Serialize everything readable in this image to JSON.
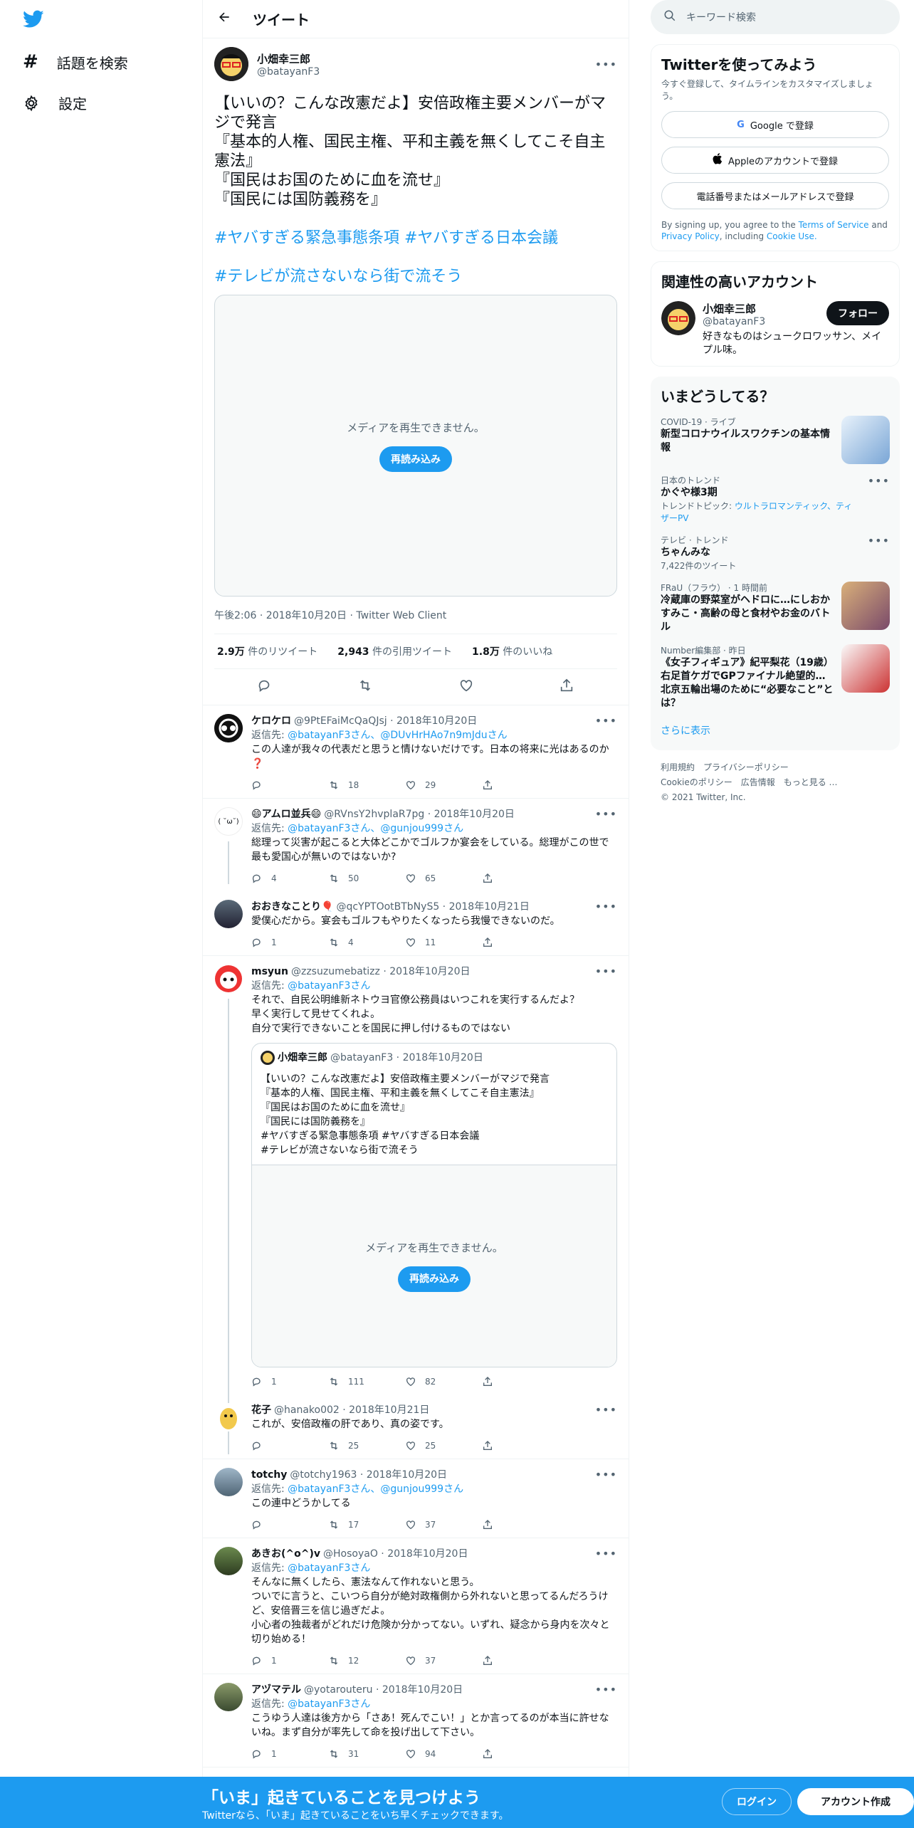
{
  "nav": {
    "explore_label": "話題を検索",
    "settings_label": "設定"
  },
  "header": {
    "title": "ツイート"
  },
  "main_tweet": {
    "name": "小畑幸三郎",
    "handle": "@batayanF3",
    "text": "【いいの？こんな改憲だよ】安倍政権主要メンバーがマジで発言\n『基本的人権、国民主権、平和主義を無くしてこそ自主憲法』\n『国民はお国のために血を流せ』\n『国民には国防義務を』",
    "hashtags_line1": "#ヤバすぎる緊急事態条項 #ヤバすぎる日本会議",
    "hashtags_line2": "#テレビが流さないなら街で流そう",
    "media_msg": "メディアを再生できません。",
    "reload_label": "再読み込み",
    "meta": "午後2:06 · 2018年10月20日 · Twitter Web Client",
    "retweets_num": "2.9万",
    "retweets_label": "件のリツイート",
    "quotes_num": "2,943",
    "quotes_label": "件の引用ツイート",
    "likes_num": "1.8万",
    "likes_label": "件のいいね"
  },
  "replies": [
    {
      "name": "ケロケロ",
      "handle": "@9PtEFaiMcQaQJsj · 2018年10月20日",
      "reply_to_prefix": "返信先: ",
      "reply_to": "@batayanF3さん、@DUvHrHAo7n9mJduさん",
      "text": "この人達が我々の代表だと思うと情けないだけです。日本の将来に光はあるのか❓",
      "replies": "",
      "rts": "18",
      "likes": "29"
    },
    {
      "name": "😄アムロ並兵😄",
      "handle": "@RVnsY2hvplaR7pg · 2018年10月20日",
      "reply_to_prefix": "返信先: ",
      "reply_to": "@batayanF3さん、@gunjou999さん",
      "text": "総理って災害が起こると大体どこかでゴルフか宴会をしている。総理がこの世で最も愛国心が無いのではないか?",
      "replies": "4",
      "rts": "50",
      "likes": "65"
    },
    {
      "name": "おおきなことり🎈",
      "handle": "@qcYPTOotBTbNyS5 · 2018年10月21日",
      "text": "愛僕心だから。宴会もゴルフもやりたくなったら我慢できないのだ。",
      "replies": "1",
      "rts": "4",
      "likes": "11"
    },
    {
      "name": "msyun",
      "handle": "@zzsuzumebatizz · 2018年10月20日",
      "reply_to_prefix": "返信先: ",
      "reply_to": "@batayanF3さん",
      "text": "それで、自民公明維新ネトウヨ官僚公務員はいつこれを実行するんだよ？\n早く実行して見せてくれよ。\n自分で実行できないことを国民に押し付けるものではない",
      "replies": "1",
      "rts": "111",
      "likes": "82",
      "quote": {
        "name": "小畑幸三郎",
        "handle": "@batayanF3 · 2018年10月20日",
        "text": "【いいの？こんな改憲だよ】安倍政権主要メンバーがマジで発言\n『基本的人権、国民主権、平和主義を無くしてこそ自主憲法』\n『国民はお国のために血を流せ』\n『国民には国防義務を』\n#ヤバすぎる緊急事態条項 #ヤバすぎる日本会議\n#テレビが流さないなら街で流そう",
        "media_msg": "メディアを再生できません。",
        "reload_label": "再読み込み"
      }
    },
    {
      "name": "花子",
      "handle": "@hanako002 · 2018年10月21日",
      "text": "これが、安倍政権の肝であり、真の姿です。",
      "replies": "",
      "rts": "25",
      "likes": "25"
    },
    {
      "name": "totchy",
      "handle": "@totchy1963 · 2018年10月20日",
      "reply_to_prefix": "返信先: ",
      "reply_to": "@batayanF3さん、@gunjou999さん",
      "text": "この連中どうかしてる",
      "replies": "",
      "rts": "17",
      "likes": "37"
    },
    {
      "name": "あきお(^o^)v",
      "handle": "@HosoyaO · 2018年10月20日",
      "reply_to_prefix": "返信先: ",
      "reply_to": "@batayanF3さん",
      "text": "そんなに無くしたら、憲法なんて作れないと思う。\nついでに言うと、こいつら自分が絶対政権側から外れないと思ってるんだろうけど、安倍晋三を信じ過ぎだよ。\n小心者の独裁者がどれだけ危険か分かってない。いずれ、疑念から身内を次々と切り始める！",
      "replies": "1",
      "rts": "12",
      "likes": "37"
    },
    {
      "name": "アヅマテル",
      "handle": "@yotarouteru · 2018年10月20日",
      "reply_to_prefix": "返信先: ",
      "reply_to": "@batayanF3さん",
      "text": "こうゆう人達は後方から「さあ！死んでこい！」とか言ってるのが本当に許せないね。まず自分が率先して命を投げ出して下さい。",
      "replies": "1",
      "rts": "31",
      "likes": "94"
    }
  ],
  "right": {
    "search_placeholder": "キーワード検索",
    "signup_title": "Twitterを使ってみよう",
    "signup_sub": "今すぐ登録して、タイムラインをカスタマイズしましょう。",
    "google_btn": "Google で登録",
    "apple_btn": "Appleのアカウントで登録",
    "phone_btn": "電話番号またはメールアドレスで登録",
    "terms_pre": "By signing up, you agree to the ",
    "terms_link": "Terms of Service",
    "terms_and": " and ",
    "privacy_link": "Privacy Policy",
    "terms_mid": ", including ",
    "cookie_link": "Cookie Use.",
    "related_title": "関連性の高いアカウント",
    "rel_name": "小畑幸三郎",
    "rel_handle": "@batayanF3",
    "rel_bio": "好きなものはシュークロワッサン、メイプル味。",
    "follow_label": "フォロー",
    "trends_title": "いまどうしてる？",
    "trends": [
      {
        "cat": "COVID-19 · ライブ",
        "title": "新型コロナウイルスワクチンの基本情報"
      },
      {
        "cat": "日本のトレンド",
        "title": "かぐや様3期",
        "topic_prefix": "トレンドトピック: ",
        "topic": "ウルトラロマンティック、ティザーPV"
      },
      {
        "cat": "テレビ · トレンド",
        "title": "ちゃんみな",
        "count": "7,422件のツイート"
      },
      {
        "cat": "FRaU（フラウ） · 1 時間前",
        "title": "冷蔵庫の野菜室がヘドロに…にしおかすみこ・高齢の母と食材やお金のバトル"
      },
      {
        "cat": "Number編集部 · 昨日",
        "title": "《女子フィギュア》紀平梨花（19歳）右足首ケガでGPファイナル絶望的…北京五輪出場のために“必要なこと”とは？"
      }
    ],
    "show_more": "さらに表示",
    "footer_line1": "利用規約　プライバシーポリシー",
    "footer_line2": "Cookieのポリシー　広告情報　もっと見る …",
    "footer_line3": "© 2021 Twitter, Inc."
  },
  "bottom": {
    "title": "「いま」起きていることを見つけよう",
    "subtitle": "Twitterなら、「いま」起きていることをいち早くチェックできます。",
    "login": "ログイン",
    "signup": "アカウント作成"
  },
  "colors": {
    "accent": "#1d9bf0",
    "text": "#0f1419",
    "secondary": "#536471"
  }
}
